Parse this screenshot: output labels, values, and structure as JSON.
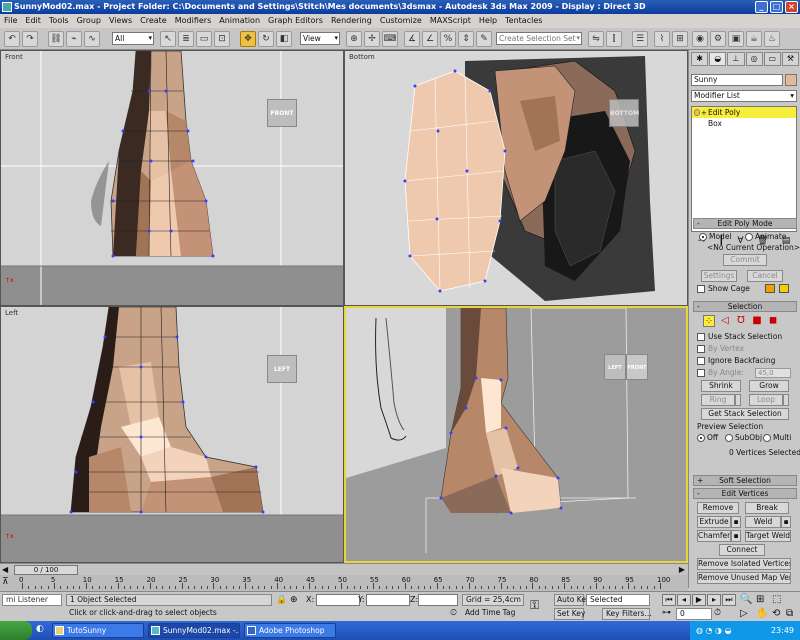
{
  "window": {
    "title": "SunnyMod02.max   - Project Folder: C:\\Documents and Settings\\Stitch\\Mes documents\\3dsmax    - Autodesk 3ds Max  2009       - Display : Direct 3D"
  },
  "menu": [
    "File",
    "Edit",
    "Tools",
    "Group",
    "Views",
    "Create",
    "Modifiers",
    "Animation",
    "Graph Editors",
    "Rendering",
    "Customize",
    "MAXScript",
    "Help",
    "Tentacles"
  ],
  "toolbar": {
    "selection_filter": "All",
    "coord_system": "View",
    "named_selection_placeholder": "Create Selection Set"
  },
  "viewports": {
    "top_left": {
      "label": "Front",
      "cube": "FRONT"
    },
    "top_right": {
      "label": "Bottom",
      "cube": "BOTTOM"
    },
    "bottom_left": {
      "label": "Left",
      "cube": "LEFT"
    },
    "bottom_right": {
      "label": "",
      "cube_left": "LEFT",
      "cube_front": "FRONT"
    }
  },
  "command_panel": {
    "object_name": "Sunny",
    "object_color": "#e6b89a",
    "modifier_list": "Modifier List",
    "stack": [
      {
        "label": "Edit Poly",
        "selected": true
      },
      {
        "label": "Box",
        "selected": false
      }
    ],
    "edit_poly_mode": {
      "title": "Edit Poly Mode",
      "model": "Model",
      "animate": "Animate",
      "current_op": "<No Current Operation>",
      "commit": "Commit",
      "settings": "Settings",
      "cancel": "Cancel",
      "show_cage": "Show Cage"
    },
    "selection": {
      "title": "Selection",
      "use_stack": "Use Stack Selection",
      "by_vertex": "By Vertex",
      "ignore_backfacing": "Ignore Backfacing",
      "by_angle": "By Angle:",
      "angle_value": "45,0",
      "shrink": "Shrink",
      "grow": "Grow",
      "ring": "Ring",
      "loop": "Loop",
      "get_stack": "Get Stack Selection",
      "preview_title": "Preview Selection",
      "preview_off": "Off",
      "preview_subobj": "SubObj",
      "preview_multi": "Multi",
      "status": "0 Vertices Selected"
    },
    "soft_selection": "Soft Selection",
    "edit_vertices": {
      "title": "Edit Vertices",
      "remove": "Remove",
      "break": "Break",
      "extrude": "Extrude",
      "weld": "Weld",
      "chamfer": "Chamfer",
      "target_weld": "Target Weld",
      "connect": "Connect",
      "remove_isolated": "Remove Isolated Vertices",
      "remove_unused": "Remove Unused Map Verts"
    }
  },
  "timeline": {
    "frame_display": "0 / 100",
    "ticks": [
      "0",
      "5",
      "10",
      "15",
      "20",
      "25",
      "30",
      "35",
      "40",
      "45",
      "50",
      "55",
      "60",
      "65",
      "70",
      "75",
      "80",
      "85",
      "90",
      "95",
      "100"
    ]
  },
  "status": {
    "listener": "mi Listener",
    "selected": "1 Object Selected",
    "prompt": "Click or click-and-drag to select objects",
    "x_label": "X:",
    "y_label": "Y:",
    "z_label": "Z:",
    "grid": "Grid = 25,4cm",
    "add_time_tag": "Add Time Tag",
    "auto_key": "Auto Key",
    "set_key": "Set Key",
    "key_mode": "Selected",
    "key_filters": "Key Filters...",
    "frame": "0"
  },
  "taskbar": {
    "tasks": [
      "TutoSunny",
      "SunnyMod02.max -...",
      "Adobe Photoshop"
    ],
    "clock": "23:49"
  }
}
